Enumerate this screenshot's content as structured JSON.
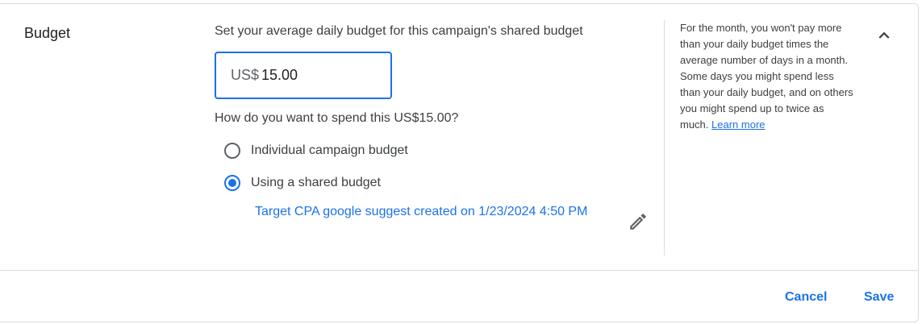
{
  "section": {
    "title": "Budget"
  },
  "budget": {
    "prompt": "Set your average daily budget for this campaign's shared budget",
    "currency_prefix": "US$",
    "amount": "15.00",
    "question": "How do you want to spend this US$15.00?"
  },
  "options": [
    {
      "label": "Individual campaign budget",
      "selected": false
    },
    {
      "label": "Using a shared budget",
      "selected": true
    }
  ],
  "shared_budget": {
    "name": "Target CPA google suggest created on 1/23/2024 4:50 PM",
    "edit_icon": "pencil-icon"
  },
  "help": {
    "text": "For the month, you won't pay more than your daily budget times the average number of days in a month. Some days you might spend less than your daily budget, and on others you might spend up to twice as much.",
    "link": "Learn more"
  },
  "actions": {
    "cancel_label": "Cancel",
    "save_label": "Save",
    "collapse_icon": "chevron-up-icon"
  },
  "colors": {
    "accent": "#1a73e8",
    "text": "#3c4043",
    "border": "#dadce0"
  }
}
